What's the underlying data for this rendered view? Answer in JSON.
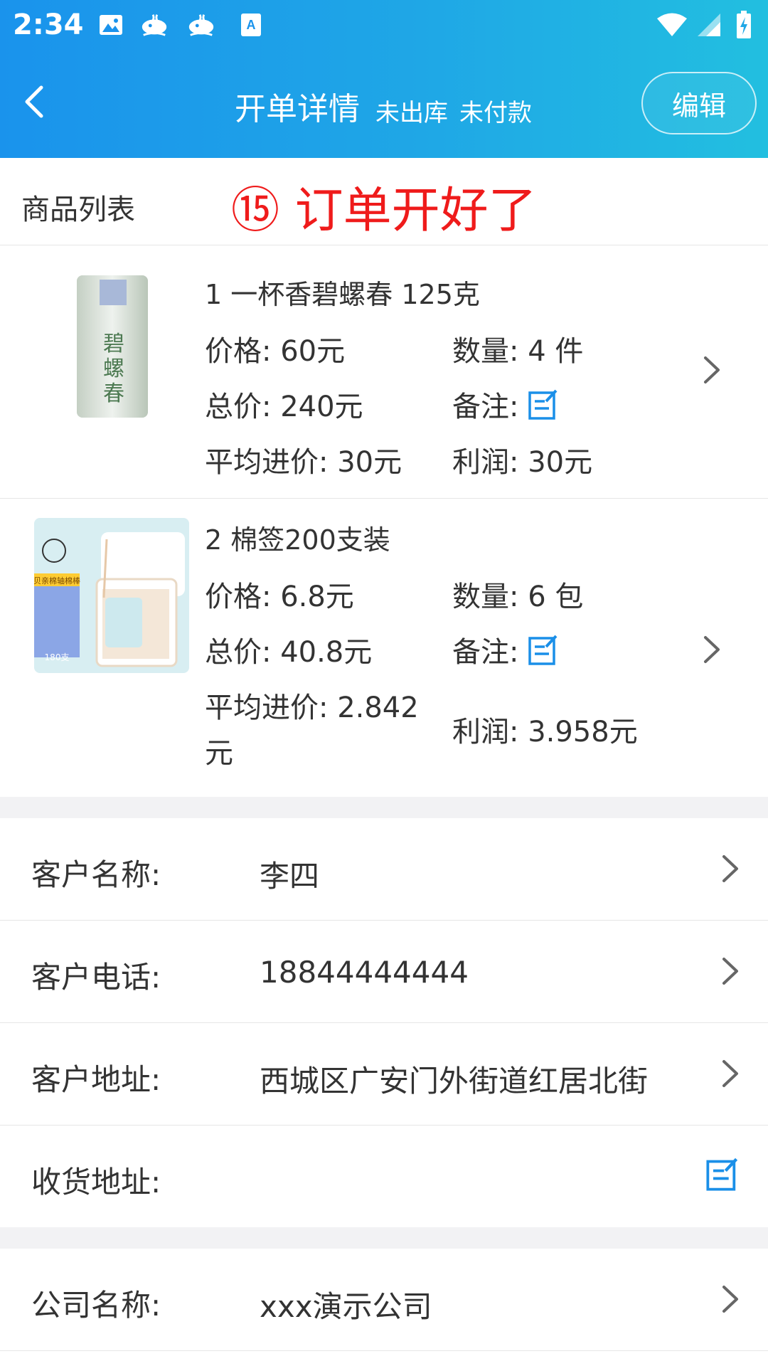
{
  "status_bar": {
    "time": "2:34",
    "icons": [
      "image-icon",
      "app-whale-icon",
      "app-whale-icon",
      "text-a-icon",
      "wifi-icon",
      "signal-icon",
      "battery-charging-icon"
    ]
  },
  "header": {
    "back_icon": "chevron-left-icon",
    "title": "开单详情",
    "status_1": "未出库",
    "status_2": "未付款",
    "edit_label": "编辑"
  },
  "product_list": {
    "label": "商品列表",
    "note": "⑮ 订单开好了",
    "note_color": "#ef1b1b",
    "items": [
      {
        "name": "1 一杯香碧螺春 125克",
        "price": "价格: 60元",
        "quantity": "数量: 4 件",
        "total": "总价: 240元",
        "remark_label": "备注:",
        "avg_cost": "平均进价: 30元",
        "profit": "利润: 30元",
        "image": "tea-can-image"
      },
      {
        "name": "2 棉签200支装",
        "price": "价格: 6.8元",
        "quantity": "数量: 6 包",
        "total": "总价: 40.8元",
        "remark_label": "备注:",
        "avg_cost_line1": "平均进价: 2.842",
        "avg_cost_line2": "元",
        "profit": "利润: 3.958元",
        "image": "cotton-swab-image"
      }
    ]
  },
  "customer": {
    "name_label": "客户名称:",
    "name_value": "李四",
    "phone_label": "客户电话:",
    "phone_value": "18844444444",
    "address_label": "客户地址:",
    "address_value": "西城区广安门外街道红居北街",
    "shipping_label": "收货地址:"
  },
  "company": {
    "name_label": "公司名称:",
    "name_value": "xxx演示公司"
  },
  "colors": {
    "header_gradient_start": "#1a93ec",
    "header_gradient_end": "#22bfe0",
    "edit_icon": "#1a8fe8",
    "chevron": "#666666"
  }
}
